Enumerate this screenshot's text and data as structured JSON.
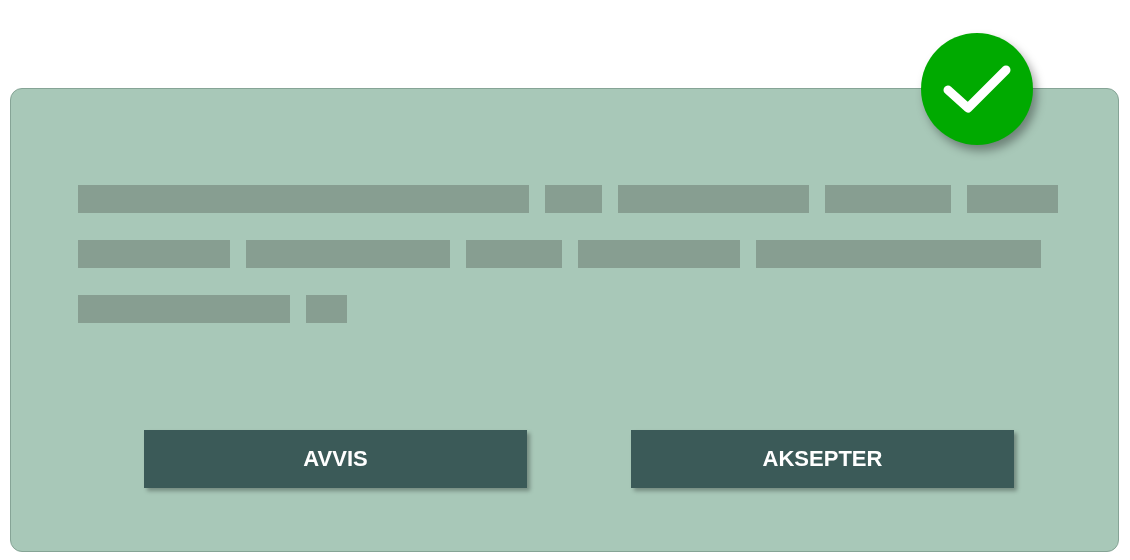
{
  "card": {
    "badge": {
      "kind": "check"
    },
    "buttons": [
      {
        "label": "AVVIS"
      },
      {
        "label": "AKSEPTER"
      }
    ]
  }
}
